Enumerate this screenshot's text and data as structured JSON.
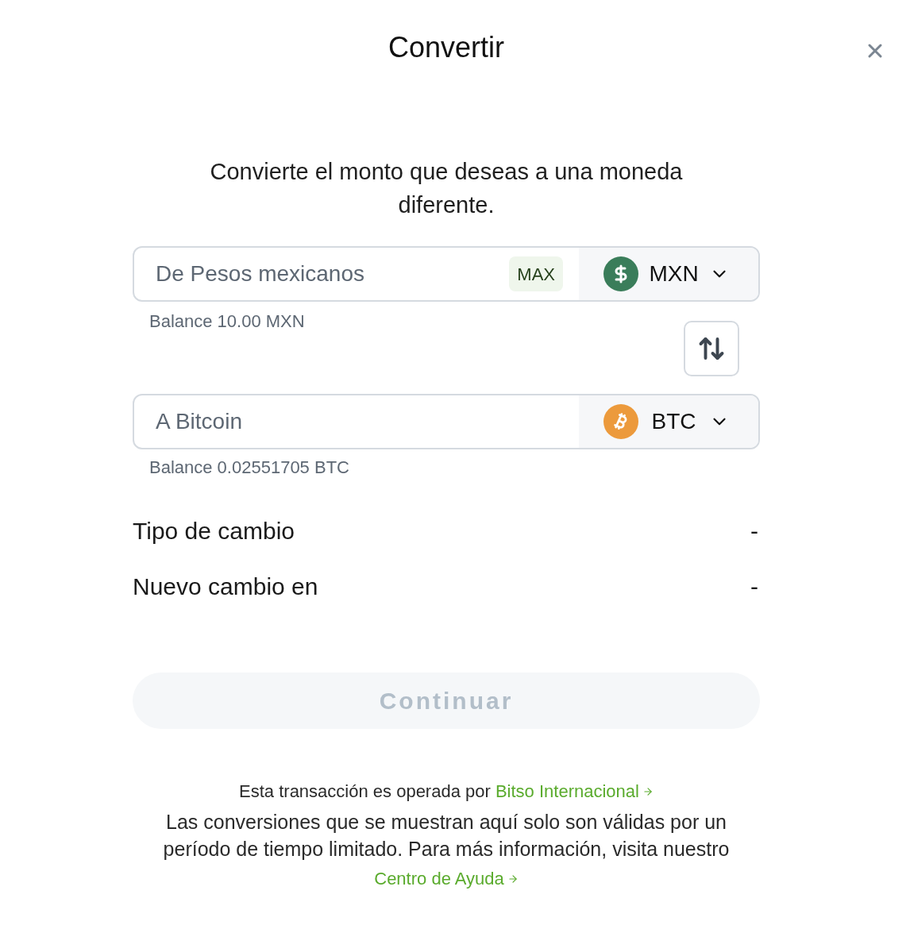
{
  "header": {
    "title": "Convertir"
  },
  "intro": "Convierte el monto que deseas a una moneda diferente.",
  "fields": [
    {
      "placeholder": "De Pesos mexicanos",
      "max_label": "MAX",
      "currency": {
        "code": "MXN",
        "kind": "peso"
      },
      "balance": "Balance 10.00 MXN"
    },
    {
      "placeholder": "A Bitcoin",
      "currency": {
        "code": "BTC",
        "kind": "bitcoin"
      },
      "balance": "Balance 0.02551705 BTC"
    }
  ],
  "details": [
    {
      "label": "Tipo de cambio",
      "value": "-"
    },
    {
      "label": "Nuevo cambio en",
      "value": "-"
    }
  ],
  "continue_button": {
    "label": "Continuar",
    "disabled": true
  },
  "footer": {
    "operator_text": "Esta transacción es operada por",
    "operator_link": "Bitso Internacional",
    "notice": "Las conversiones que se muestran aquí solo son válidas por un período de tiempo limitado. Para más información, visita nuestro",
    "help_link": "Centro de Ayuda"
  }
}
